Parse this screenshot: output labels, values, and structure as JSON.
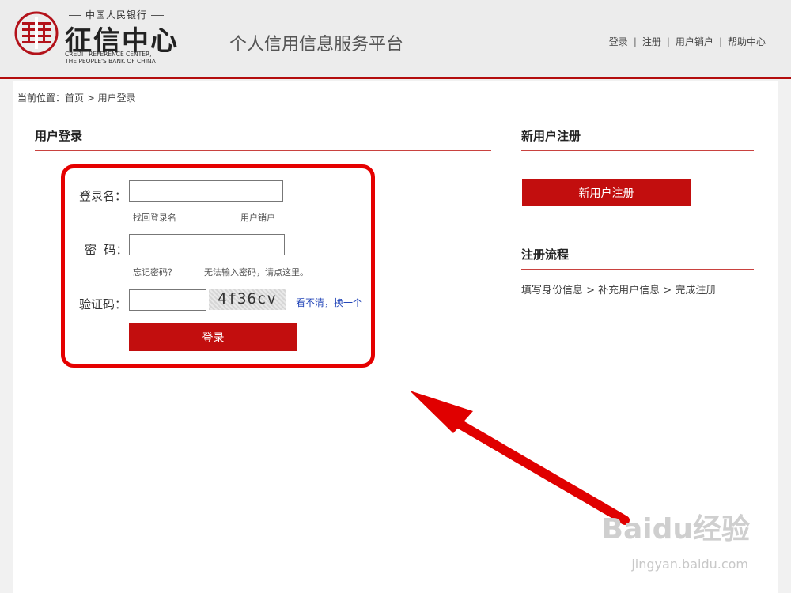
{
  "header": {
    "logo_top": "中国人民银行",
    "logo_cn": "征信中心",
    "logo_en_line1": "CREDIT REFERENCE CENTER,",
    "logo_en_line2": "THE PEOPLE'S BANK OF CHINA",
    "site_title": "个人信用信息服务平台",
    "nav": [
      "登录",
      "注册",
      "用户销户",
      "帮助中心"
    ]
  },
  "breadcrumb": "当前位置：首页 > 用户登录",
  "login": {
    "title": "用户登录",
    "username_label": "登录名：",
    "username_value": "",
    "recover_name_link": "找回登录名",
    "cancel_account_link": "用户销户",
    "password_label": "密  码：",
    "password_value": "",
    "forgot_password_link": "忘记密码？",
    "cannot_input_link": "无法输入密码，请点这里。",
    "captcha_label": "验证码：",
    "captcha_value": "",
    "captcha_text": "4f36cv",
    "refresh_captcha_link": "看不清，换一个",
    "login_button": "登录"
  },
  "register": {
    "title": "新用户注册",
    "button": "新用户注册"
  },
  "flow": {
    "title": "注册流程",
    "steps": "填写身份信息 > 补充用户信息 > 完成注册"
  },
  "watermark": {
    "text": "Baidu经验",
    "url": "jingyan.baidu.com"
  },
  "colors": {
    "brand_red": "#c20e0e",
    "highlight_red": "#e50000",
    "link_blue": "#2346b8"
  }
}
